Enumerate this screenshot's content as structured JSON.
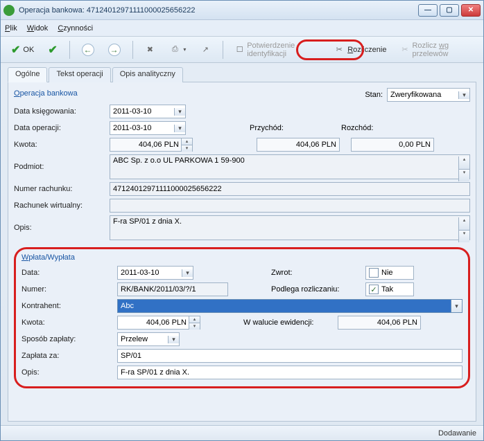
{
  "window": {
    "title": "Operacja bankowa: 47124012971111000025656222"
  },
  "menu": {
    "file": "Plik",
    "view": "Widok",
    "actions": "Czynności"
  },
  "toolbar": {
    "ok": "OK",
    "confirm_id": "Potwierdzenie identyfikacji",
    "settlement": "Rozliczenie",
    "settle_by_transfers": "Rozlicz wg przelewów"
  },
  "tabs": {
    "general": "Ogólne",
    "op_text": "Tekst operacji",
    "analytic": "Opis analityczny"
  },
  "section1": {
    "title": "Operacja bankowa",
    "stan_label": "Stan:",
    "stan_value": "Zweryfikowana",
    "data_ksieg_label": "Data księgowania:",
    "data_ksieg": "2011-03-10",
    "data_oper_label": "Data operacji:",
    "data_oper": "2011-03-10",
    "przychod_label": "Przychód:",
    "rozchod_label": "Rozchód:",
    "kwota_label": "Kwota:",
    "kwota": "404,06 PLN",
    "przychod": "404,06 PLN",
    "rozchod": "0,00 PLN",
    "podmiot_label": "Podmiot:",
    "podmiot": "ABC Sp. z o.o UL PARKOWA 1 59-900",
    "numer_rach_label": "Numer rachunku:",
    "numer_rach": "47124012971111000025656222",
    "rach_wirt_label": "Rachunek wirtualny:",
    "rach_wirt": "",
    "opis_label": "Opis:",
    "opis": "F-ra SP/01 z dnia X."
  },
  "section2": {
    "title": "Wpłata/Wypłata",
    "data_label": "Data:",
    "data": "2011-03-10",
    "zwrot_label": "Zwrot:",
    "zwrot_value": "Nie",
    "numer_label": "Numer:",
    "numer": "RK/BANK/2011/03/?/1",
    "podlega_label": "Podlega rozliczaniu:",
    "podlega_value": "Tak",
    "kontrahent_label": "Kontrahent:",
    "kontrahent": "Abc",
    "kwota_label": "Kwota:",
    "kwota": "404,06 PLN",
    "waluta_label": "W walucie ewidencji:",
    "waluta": "404,06 PLN",
    "sposob_label": "Sposób zapłaty:",
    "sposob": "Przelew",
    "zaplata_label": "Zapłata za:",
    "zaplata": "SP/01",
    "opis_label": "Opis:",
    "opis": "F-ra SP/01 z dnia X."
  },
  "statusbar": {
    "mode": "Dodawanie"
  }
}
